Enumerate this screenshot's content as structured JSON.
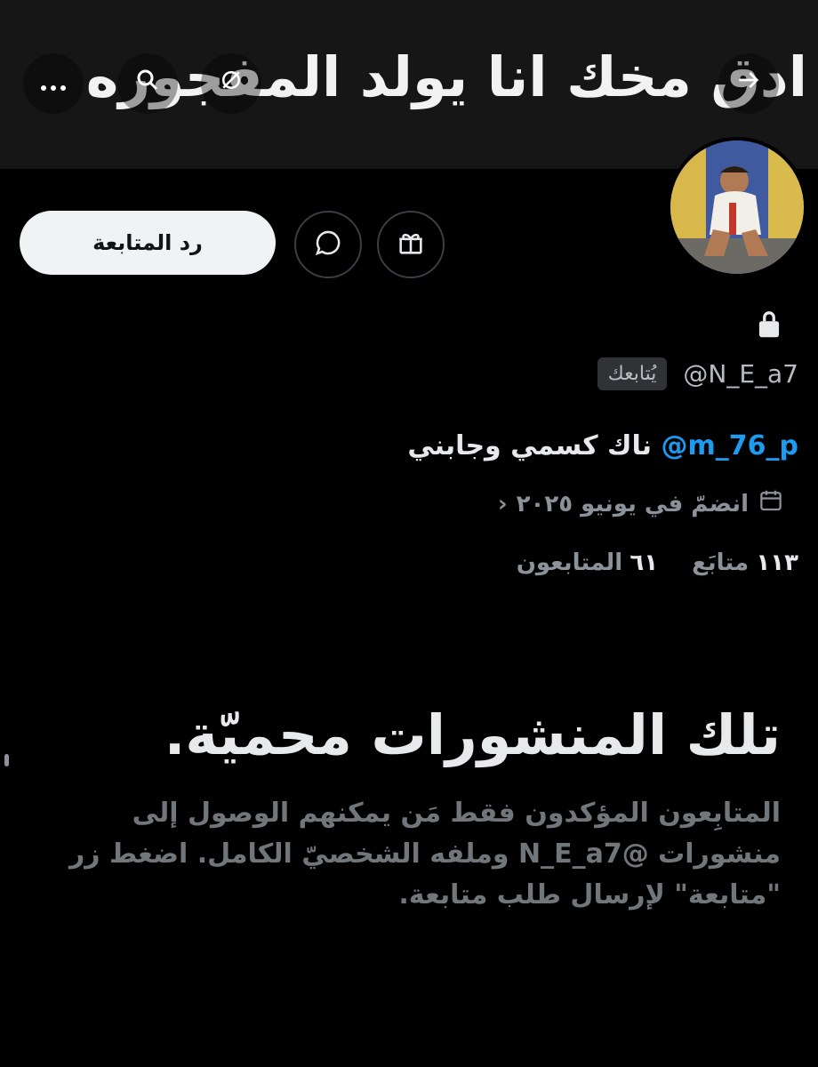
{
  "banner": {
    "text": "ادق مخك انا يولد المفجوره"
  },
  "header": {
    "back_icon": "arrow-right-icon",
    "more_icon": "more-dots-icon",
    "search_icon": "search-icon",
    "hide_icon": "eye-off-icon"
  },
  "profile": {
    "handle": "@N_E_a7",
    "follows_you_badge": "يُتابعك",
    "bio_mention": "@m_76_p",
    "bio_text": "ناك كسمي وجابني",
    "joined": "انضمّ في يونيو ٢٠٢٥",
    "following_count": "١١٣",
    "following_label": "متابَع",
    "followers_count": "٦١",
    "followers_label": "المتابعون"
  },
  "actions": {
    "follow_back_label": "رد المتابعة",
    "message_icon": "message-bubble-icon",
    "gift_icon": "gift-icon"
  },
  "protected": {
    "title": "تلك المنشورات محميّة.",
    "body": "المتابِعون المؤكدون فقط مَن يمكنهم الوصول إلى منشورات @N_E_a7 وملفه الشخصيّ الكامل. اضغط زر \"متابعة\" لإرسال طلب متابعة."
  },
  "colors": {
    "background": "#000000",
    "mention": "#1d9bf0",
    "secondary_text": "#71767b",
    "button_bg": "#eff3f4"
  }
}
